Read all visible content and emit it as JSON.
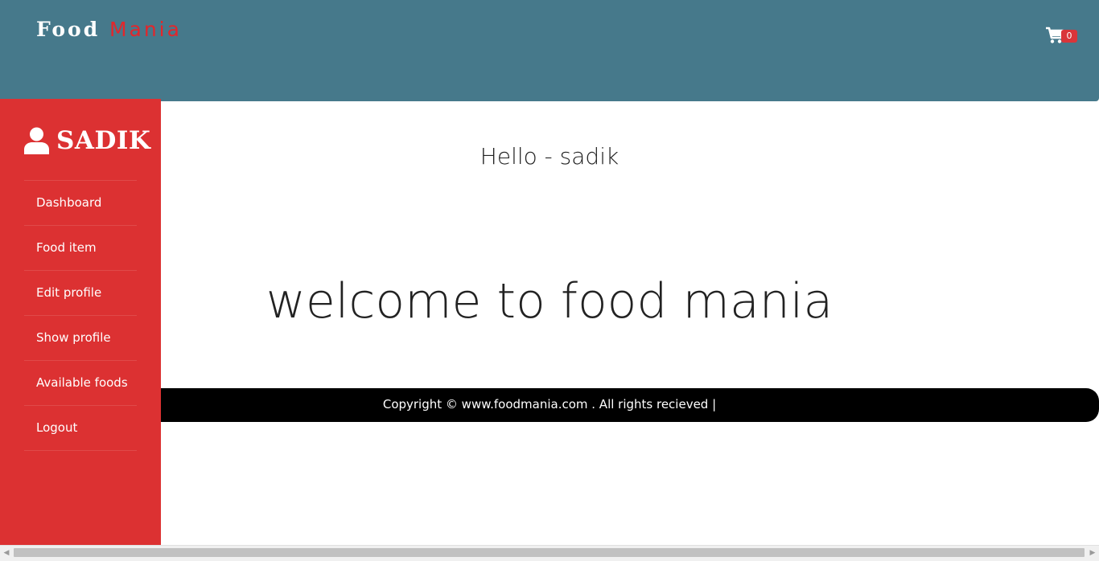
{
  "header": {
    "brand_first": "Food",
    "brand_second": "Mania",
    "cart_count": "0",
    "cart_icon": "shopping-cart-icon",
    "background": "#46798b",
    "accent": "#e3262b"
  },
  "sidebar": {
    "user_icon": "user-icon",
    "user_name": "SADIK",
    "background": "#dc3132",
    "items": [
      {
        "label": "Dashboard"
      },
      {
        "label": "Food item"
      },
      {
        "label": "Edit profile"
      },
      {
        "label": "Show profile"
      },
      {
        "label": "Available foods"
      },
      {
        "label": "Logout"
      }
    ]
  },
  "main": {
    "greeting": "Hello - sadik",
    "welcome": "welcome to food mania"
  },
  "footer": {
    "copyright": "Copyright © www.foodmania.com . All rights recieved |"
  }
}
